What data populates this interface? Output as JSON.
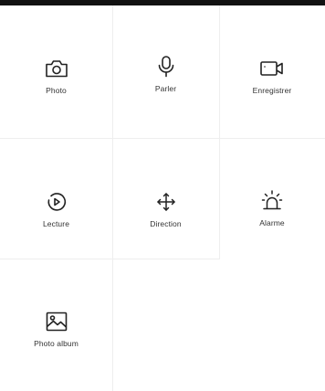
{
  "controls": [
    {
      "label": "Photo",
      "icon": "camera-icon"
    },
    {
      "label": "Parler",
      "icon": "microphone-icon"
    },
    {
      "label": "Enregistrer",
      "icon": "video-camera-icon"
    },
    {
      "label": "Lecture",
      "icon": "playback-icon"
    },
    {
      "label": "Direction",
      "icon": "move-arrows-icon"
    },
    {
      "label": "Alarme",
      "icon": "alarm-siren-icon"
    },
    {
      "label": "Photo album",
      "icon": "image-gallery-icon"
    }
  ],
  "colors": {
    "background": "#ffffff",
    "top_bar": "#121212",
    "divider": "#eeeeee",
    "icon_stroke": "#222222",
    "label_text": "#333333"
  }
}
